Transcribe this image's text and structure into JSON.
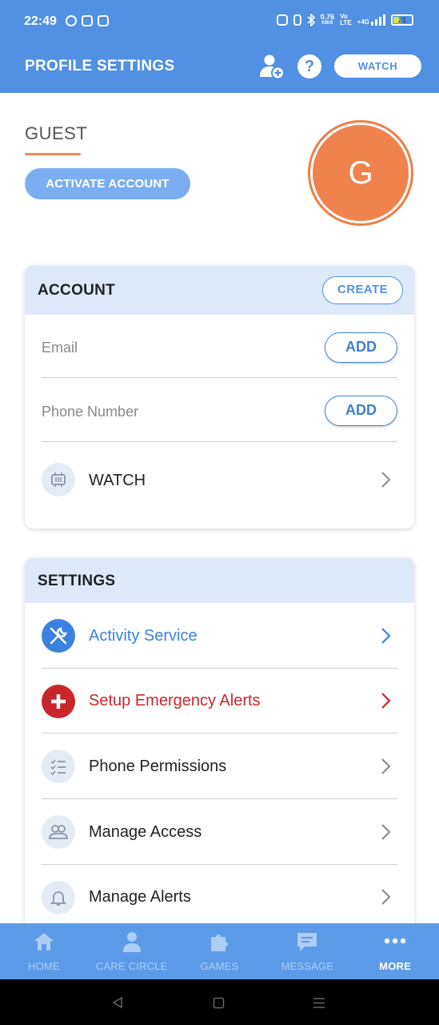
{
  "status_bar": {
    "time": "22:49",
    "network_speed_value": "0.76",
    "network_speed_unit": "KB/S",
    "network_type": "+4G",
    "battery_level": "21"
  },
  "app_bar": {
    "title": "PROFILE SETTINGS",
    "help_label": "?",
    "watch_button": "WATCH"
  },
  "profile": {
    "name": "GUEST",
    "activate_button": "ACTIVATE ACCOUNT",
    "avatar_letter": "G"
  },
  "account": {
    "title": "ACCOUNT",
    "create_button": "CREATE",
    "email_label": "Email",
    "email_add": "ADD",
    "phone_label": "Phone Number",
    "phone_add": "ADD",
    "watch_item": "WATCH"
  },
  "settings": {
    "title": "SETTINGS",
    "items": [
      {
        "label": "Activity Service",
        "icon": "wrench-icon",
        "color": "#3b82e0"
      },
      {
        "label": "Setup Emergency Alerts",
        "icon": "plus-icon",
        "color": "#c9262b"
      },
      {
        "label": "Phone Permissions",
        "icon": "checklist-icon",
        "color": "#222222"
      },
      {
        "label": "Manage Access",
        "icon": "people-icon",
        "color": "#222222"
      },
      {
        "label": "Manage Alerts",
        "icon": "bell-icon",
        "color": "#222222"
      }
    ]
  },
  "bottom_nav": {
    "items": [
      {
        "label": "HOME",
        "icon": "home-icon"
      },
      {
        "label": "CARE CIRCLE",
        "icon": "person-icon"
      },
      {
        "label": "GAMES",
        "icon": "puzzle-icon"
      },
      {
        "label": "MESSAGE",
        "icon": "message-icon"
      },
      {
        "label": "MORE",
        "icon": "more-dots-icon"
      }
    ],
    "active": "MORE"
  },
  "colors": {
    "primary": "#5190e2",
    "accent_orange": "#f0834d",
    "danger": "#c9262b",
    "card_header_bg": "#dde9f8"
  }
}
